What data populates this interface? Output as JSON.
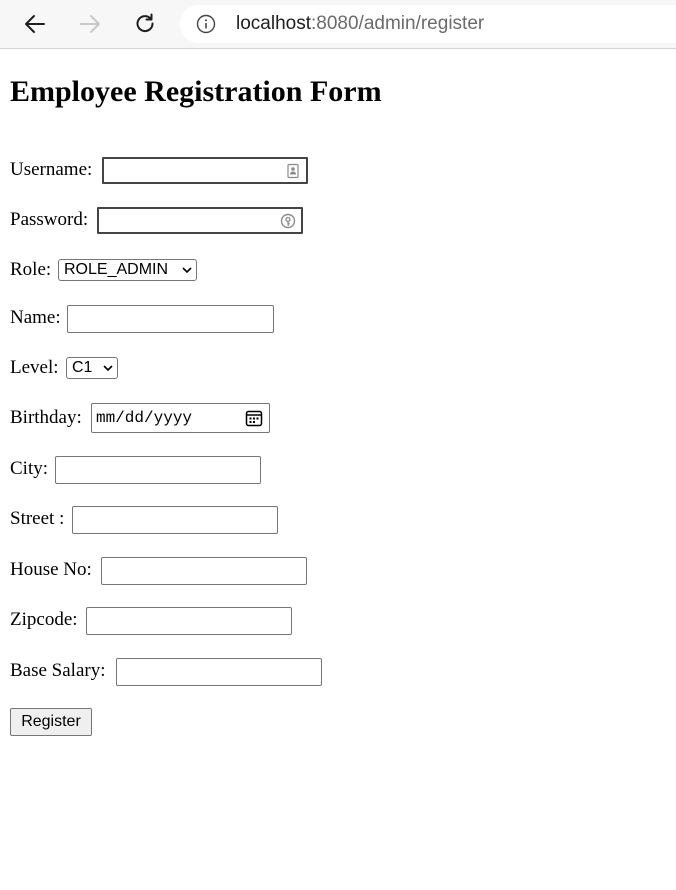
{
  "browser": {
    "url_host": "localhost",
    "url_rest": ":8080/admin/register"
  },
  "page": {
    "title": "Employee Registration Form"
  },
  "form": {
    "username_label": "Username:",
    "password_label": "Password:",
    "role_label": "Role:",
    "role_value": "ROLE_ADMIN",
    "name_label": "Name:",
    "level_label": "Level:",
    "level_value": "C1",
    "birthday_label": "Birthday:",
    "birthday_placeholder": "mm/dd/yyyy",
    "city_label": "City:",
    "street_label": "Street :",
    "house_no_label": "House No:",
    "zipcode_label": "Zipcode:",
    "base_salary_label": "Base Salary:",
    "submit_label": "Register"
  },
  "icons": {
    "back": "arrow-left-icon",
    "forward": "arrow-right-icon",
    "reload": "reload-icon",
    "site_info": "info-icon",
    "username_field": "contact-card-icon",
    "password_field": "password-key-icon",
    "dropdown": "chevron-down-icon",
    "birthday_field": "calendar-icon"
  }
}
